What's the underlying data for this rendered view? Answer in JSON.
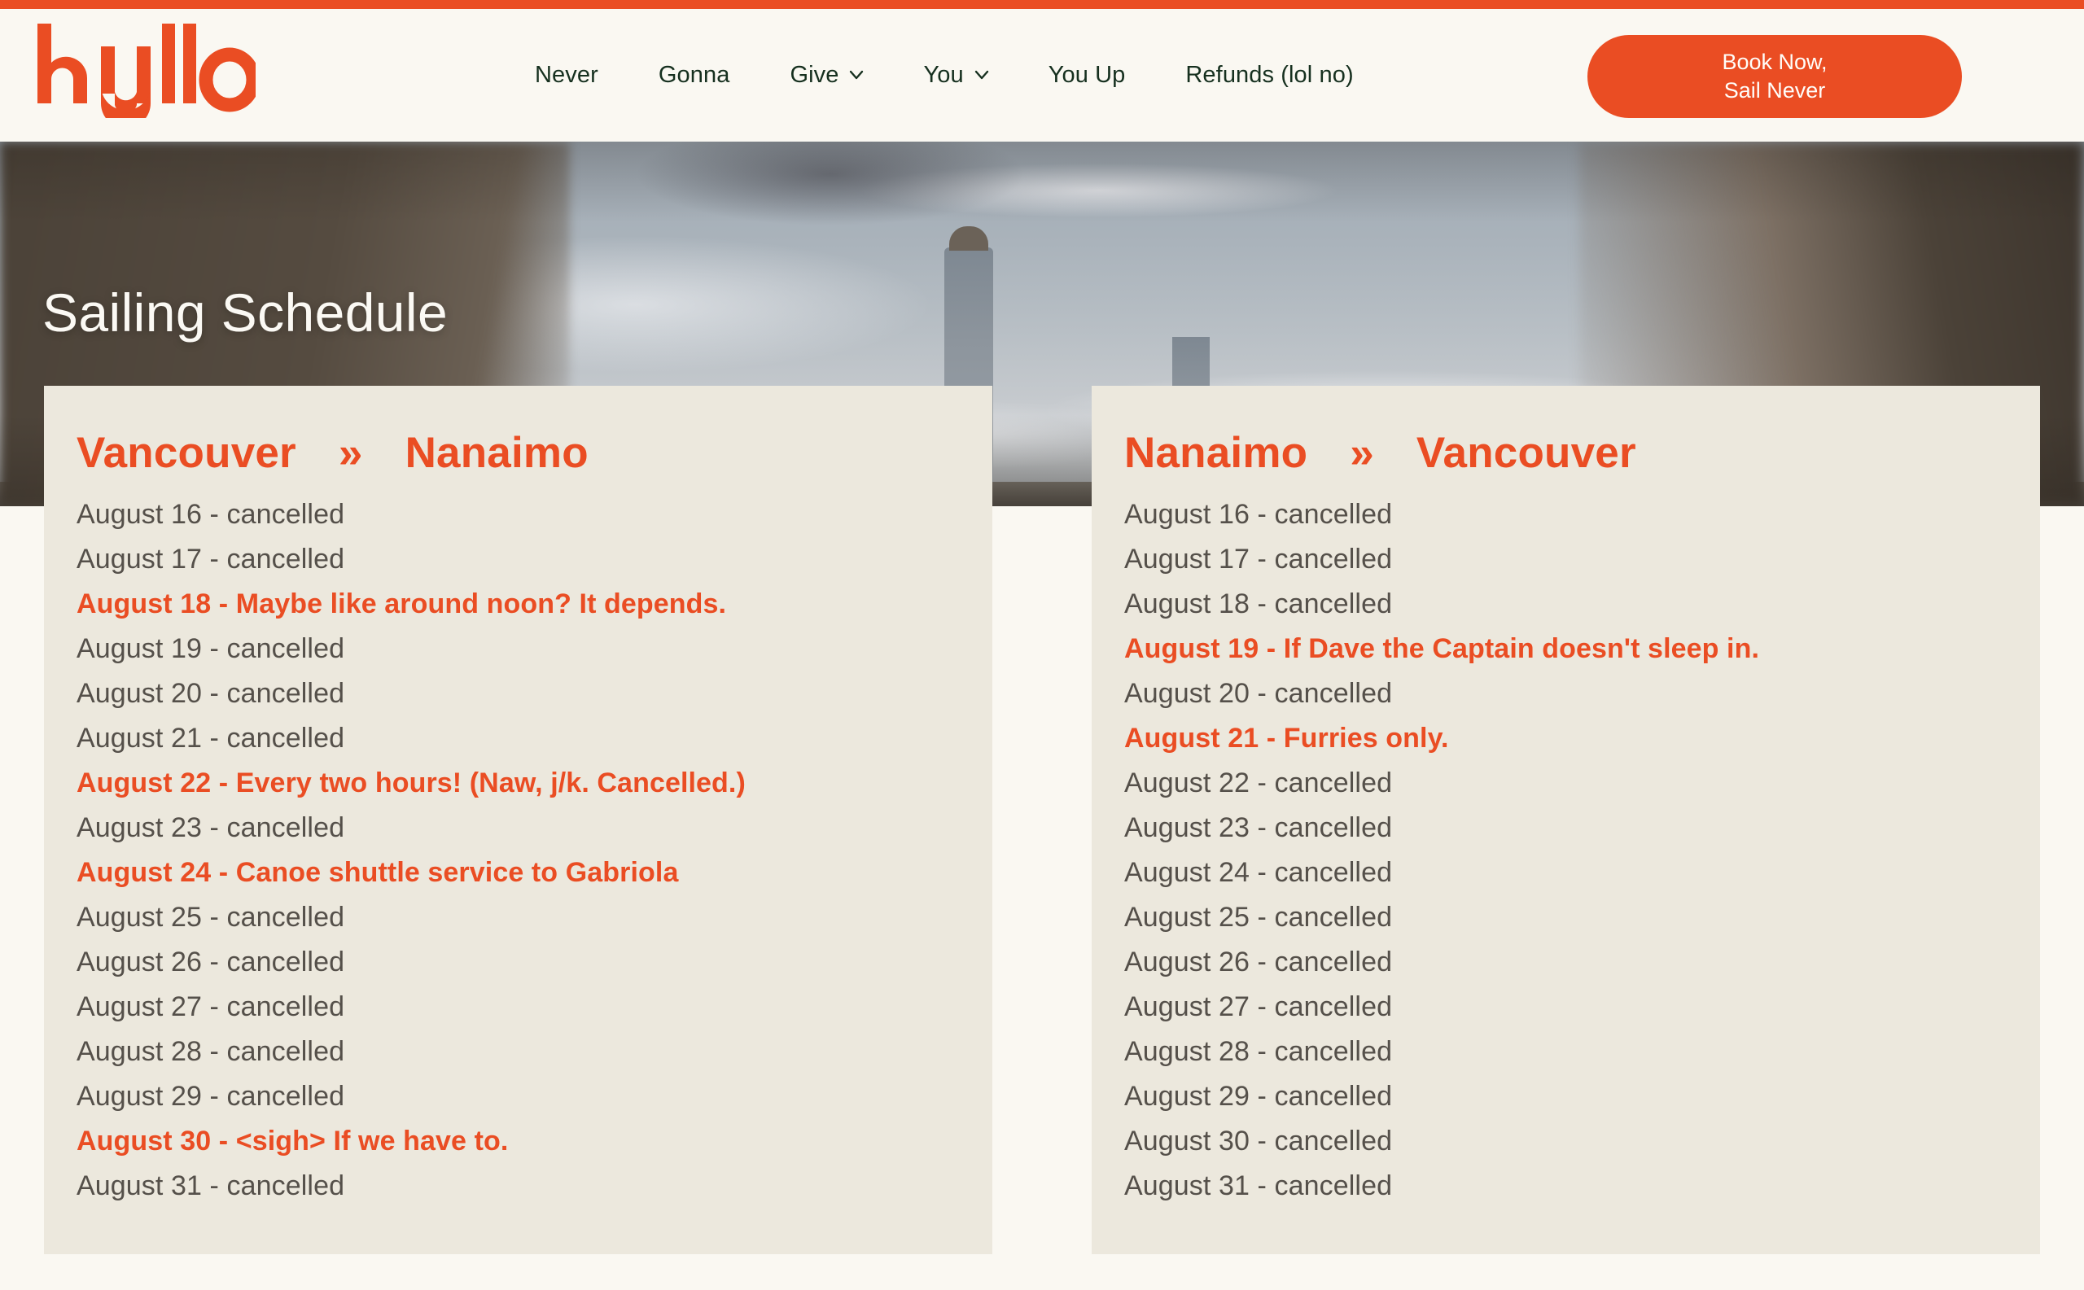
{
  "theme": {
    "accent": "#ea4d23",
    "page_bg": "#faf8f2",
    "card_bg": "#ece8dd",
    "body_text": "#55504a",
    "nav_text": "#16301f"
  },
  "header": {
    "logo_text": "hullo",
    "nav": [
      {
        "label": "Never",
        "has_dropdown": false
      },
      {
        "label": "Gonna",
        "has_dropdown": false
      },
      {
        "label": "Give",
        "has_dropdown": true,
        "dropdown_icon": "chevron-down-icon"
      },
      {
        "label": "You",
        "has_dropdown": true,
        "dropdown_icon": "chevron-down-icon"
      },
      {
        "label": "You Up",
        "has_dropdown": false
      },
      {
        "label": "Refunds (lol no)",
        "has_dropdown": false
      }
    ],
    "cta": {
      "line1": "Book Now,",
      "line2": "Sail Never"
    }
  },
  "hero": {
    "title": "Sailing Schedule"
  },
  "schedule": {
    "arrow_glyph": "»",
    "cards": [
      {
        "from": "Vancouver",
        "to": "Nanaimo",
        "rows": [
          {
            "text": "August 16 - cancelled",
            "highlight": false
          },
          {
            "text": "August 17 - cancelled",
            "highlight": false
          },
          {
            "text": "August 18 - Maybe like around noon? It depends.",
            "highlight": true
          },
          {
            "text": "August 19 - cancelled",
            "highlight": false
          },
          {
            "text": "August 20 - cancelled",
            "highlight": false
          },
          {
            "text": "August 21 - cancelled",
            "highlight": false
          },
          {
            "text": "August 22 - Every two hours! (Naw, j/k. Cancelled.)",
            "highlight": true
          },
          {
            "text": "August 23 - cancelled",
            "highlight": false
          },
          {
            "text": "August 24 - Canoe shuttle service to Gabriola",
            "highlight": true
          },
          {
            "text": "August 25 - cancelled",
            "highlight": false
          },
          {
            "text": "August 26 - cancelled",
            "highlight": false
          },
          {
            "text": "August 27 - cancelled",
            "highlight": false
          },
          {
            "text": "August 28 - cancelled",
            "highlight": false
          },
          {
            "text": "August 29 - cancelled",
            "highlight": false
          },
          {
            "text": "August 30 - <sigh> If we have to.",
            "highlight": true
          },
          {
            "text": "August 31 - cancelled",
            "highlight": false
          }
        ]
      },
      {
        "from": "Nanaimo",
        "to": "Vancouver",
        "rows": [
          {
            "text": "August 16 - cancelled",
            "highlight": false
          },
          {
            "text": "August 17 - cancelled",
            "highlight": false
          },
          {
            "text": "August 18 - cancelled",
            "highlight": false
          },
          {
            "text": "August 19 - If Dave the Captain doesn't sleep in.",
            "highlight": true
          },
          {
            "text": "August 20 - cancelled",
            "highlight": false
          },
          {
            "text": "August 21 - Furries only.",
            "highlight": true
          },
          {
            "text": "August 22 - cancelled",
            "highlight": false
          },
          {
            "text": "August 23 - cancelled",
            "highlight": false
          },
          {
            "text": "August 24 - cancelled",
            "highlight": false
          },
          {
            "text": "August 25 - cancelled",
            "highlight": false
          },
          {
            "text": "August 26 - cancelled",
            "highlight": false
          },
          {
            "text": "August 27 - cancelled",
            "highlight": false
          },
          {
            "text": "August 28 - cancelled",
            "highlight": false
          },
          {
            "text": "August 29 - cancelled",
            "highlight": false
          },
          {
            "text": "August 30 - cancelled",
            "highlight": false
          },
          {
            "text": "August 31 - cancelled",
            "highlight": false
          }
        ]
      }
    ]
  }
}
